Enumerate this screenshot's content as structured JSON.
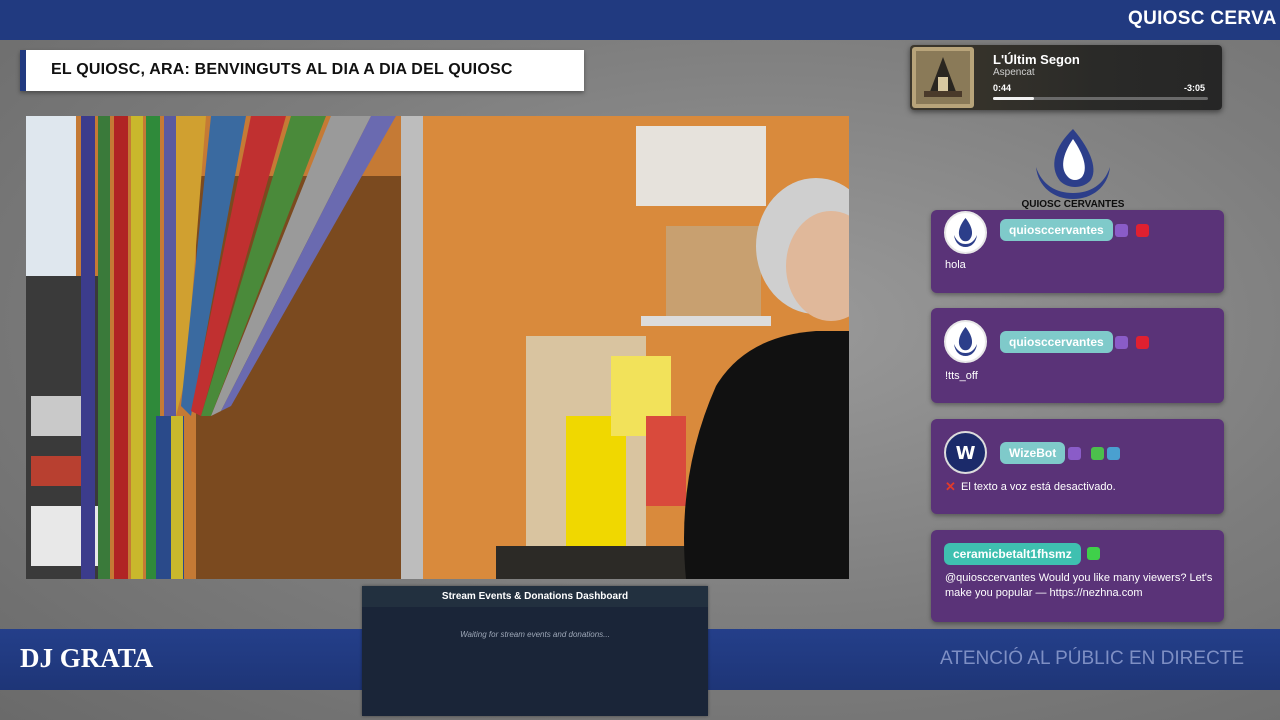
{
  "ticker": {
    "text": "QUIOSC CERVA"
  },
  "title": {
    "text": "EL QUIOSC, ARA: BENVINGUTS AL DIA A DIA DEL QUIOSC"
  },
  "music": {
    "track": "L'Últim Segon",
    "artist": "Aspencat",
    "elapsed": "0:44",
    "remaining": "-3:05",
    "progress": 0.19
  },
  "logo": {
    "text": "QUIOSC CERVANTES"
  },
  "chat": {
    "messages": [
      {
        "username": "quiosccervantes",
        "text": "hola",
        "badges": [
          "twitch-icon",
          "video-icon"
        ]
      },
      {
        "username": "quiosccervantes",
        "text": "!tts_off",
        "badges": [
          "twitch-icon",
          "video-icon"
        ]
      },
      {
        "username": "WizeBot",
        "text": "El texto a voz está desactivado.",
        "badges": [
          "twitch-icon",
          "wrench-icon",
          "robot-icon"
        ],
        "prefix_icon": "red-x-icon"
      },
      {
        "username": "ceramicbetalt1fhsmz",
        "text_line1": "@quiosccervantes Would you like many viewers? Let's",
        "text_line2": "make you popular — https://nezhna.com",
        "badges": [
          "gift-icon"
        ]
      }
    ]
  },
  "bottom": {
    "left": "DJ GRATA",
    "right": "ATENCIÓ AL PÚBLIC EN DIRECTE"
  },
  "dashboard": {
    "title": "Stream Events & Donations Dashboard",
    "status": "Waiting for stream events and donations..."
  },
  "colors": {
    "brand_blue": "#213a80",
    "chat_purple": "#5a3378",
    "username_teal": "#7fcaca"
  }
}
